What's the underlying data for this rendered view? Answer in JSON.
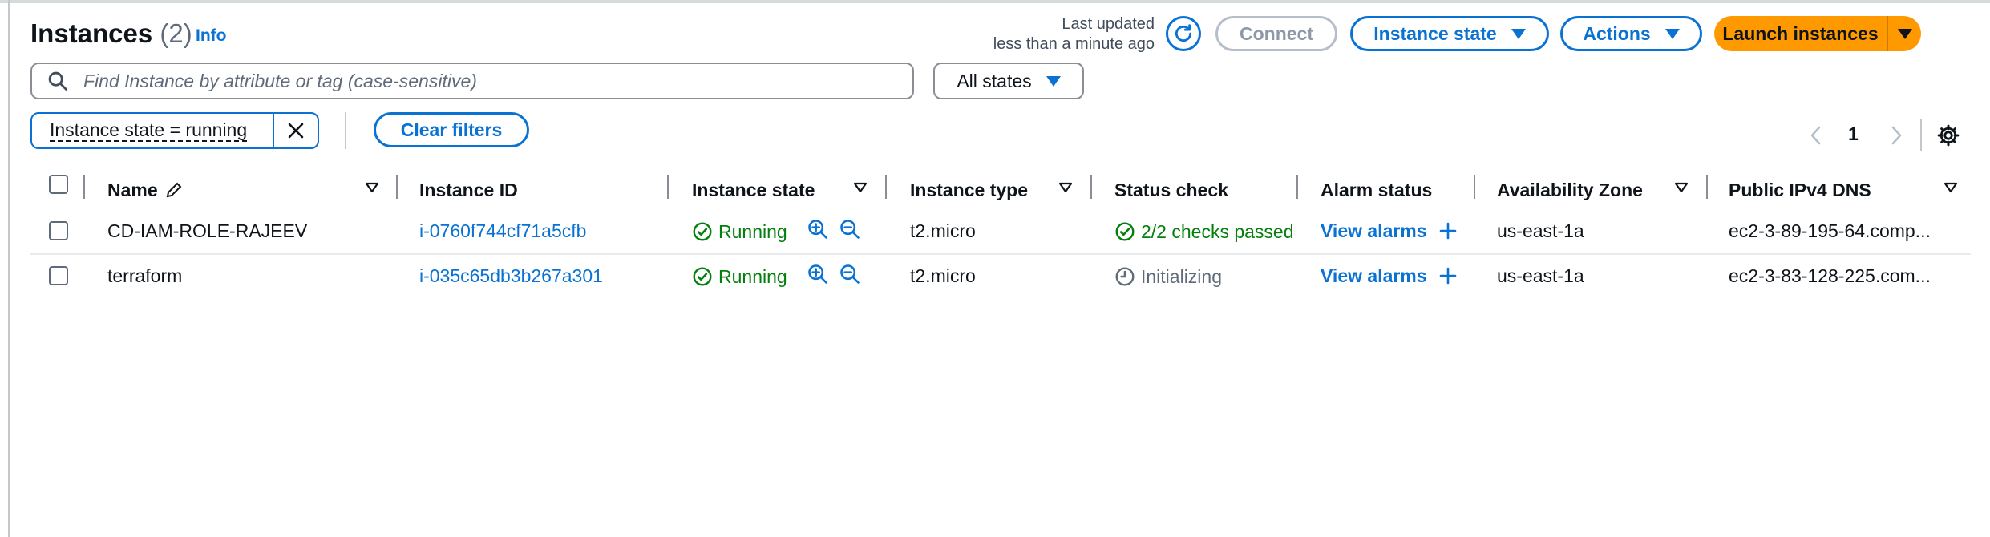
{
  "header": {
    "title": "Instances",
    "count": "(2)",
    "info": "Info",
    "last_updated_line1": "Last updated",
    "last_updated_line2": "less than a minute ago"
  },
  "toolbar": {
    "connect": "Connect",
    "instance_state": "Instance state",
    "actions": "Actions",
    "launch": "Launch instances"
  },
  "filter": {
    "search_placeholder": "Find Instance by attribute or tag (case-sensitive)",
    "states_selected": "All states",
    "token": "Instance state = running",
    "clear": "Clear filters"
  },
  "pagination": {
    "page": "1"
  },
  "columns": {
    "name": "Name",
    "instance_id": "Instance ID",
    "instance_state": "Instance state",
    "instance_type": "Instance type",
    "status_check": "Status check",
    "alarm_status": "Alarm status",
    "availability_zone": "Availability Zone",
    "public_dns": "Public IPv4 DNS"
  },
  "rows": [
    {
      "name": "CD-IAM-ROLE-RAJEEV",
      "instance_id": "i-0760f744cf71a5cfb",
      "state": "Running",
      "type": "t2.micro",
      "status_check": "2/2 checks passed",
      "alarm": "View alarms",
      "zone": "us-east-1a",
      "dns": "ec2-3-89-195-64.comp..."
    },
    {
      "name": "terraform",
      "instance_id": "i-035c65db3b267a301",
      "state": "Running",
      "type": "t2.micro",
      "status_check": "Initializing",
      "alarm": "View alarms",
      "zone": "us-east-1a",
      "dns": "ec2-3-83-128-225.com..."
    }
  ],
  "colors": {
    "link": "#0972d3",
    "success": "#037f0c",
    "primary": "#ff9900",
    "muted": "#5f6b7a"
  }
}
